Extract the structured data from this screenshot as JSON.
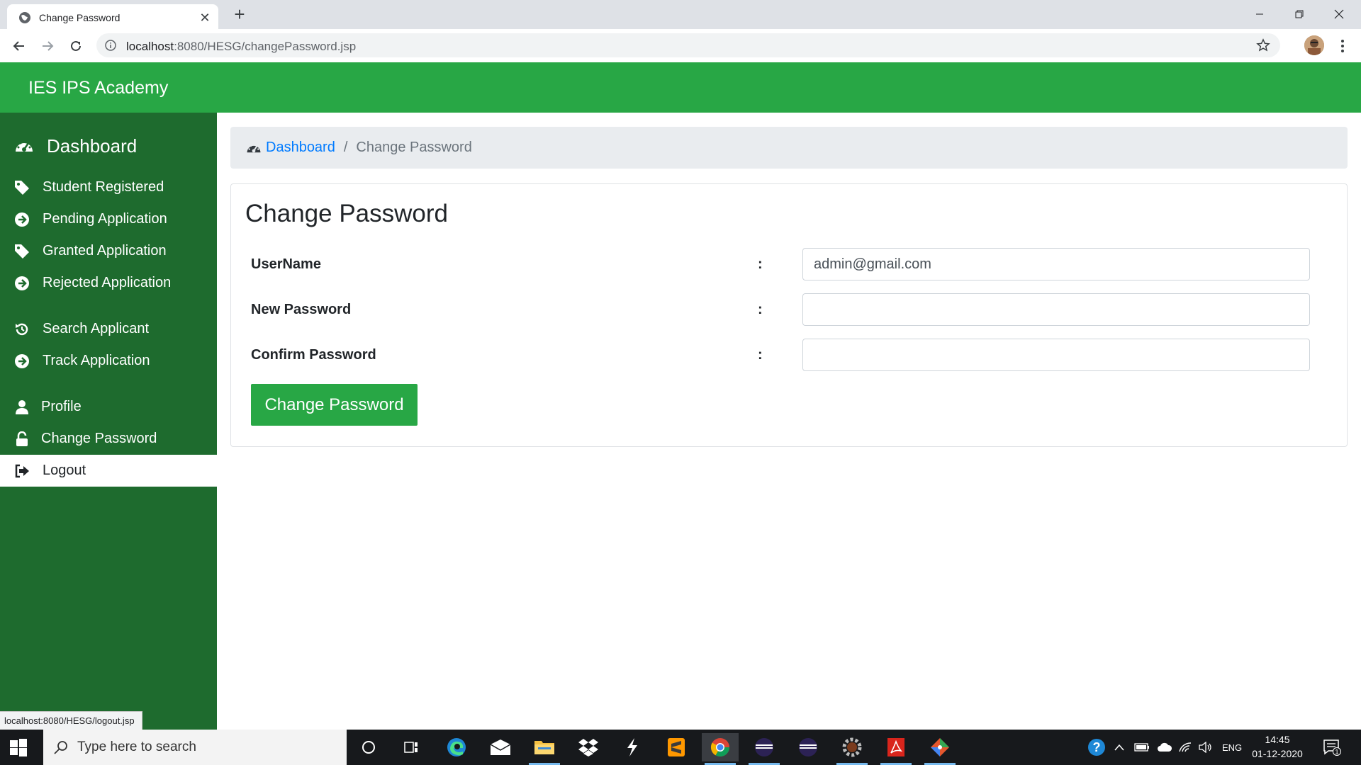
{
  "browser": {
    "tab_title": "Change Password",
    "url_host": "localhost",
    "url_rest": ":8080/HESG/changePassword.jsp",
    "status_url": "localhost:8080/HESG/logout.jsp"
  },
  "app": {
    "brand": "IES IPS Academy",
    "accent": "#28a745",
    "sidebar_bg": "#1e6b2e"
  },
  "sidebar": {
    "items": [
      {
        "label": "Dashboard",
        "icon": "dashboard-gauge-icon"
      },
      {
        "label": "Student Registered",
        "icon": "tag-icon"
      },
      {
        "label": "Pending Application",
        "icon": "arrow-circle-right-icon"
      },
      {
        "label": "Granted Application",
        "icon": "tag-icon"
      },
      {
        "label": "Rejected Application",
        "icon": "arrow-circle-right-icon"
      },
      {
        "label": "Search Applicant",
        "icon": "history-icon"
      },
      {
        "label": "Track Application",
        "icon": "arrow-circle-right-icon"
      },
      {
        "label": "Profile",
        "icon": "user-icon"
      },
      {
        "label": "Change Password",
        "icon": "unlock-icon"
      },
      {
        "label": "Logout",
        "icon": "sign-out-icon"
      }
    ]
  },
  "breadcrumb": {
    "home": "Dashboard",
    "separator": "/",
    "current": "Change Password"
  },
  "form": {
    "title": "Change Password",
    "colon": ":",
    "username_label": "UserName",
    "username_value": "admin@gmail.com",
    "new_password_label": "New Password",
    "new_password_value": "",
    "confirm_password_label": "Confirm Password",
    "confirm_password_value": "",
    "submit_label": "Change Password"
  },
  "taskbar": {
    "search_placeholder": "Type here to search",
    "language": "ENG",
    "time": "14:45",
    "date": "01-12-2020",
    "notification_count": "1"
  }
}
